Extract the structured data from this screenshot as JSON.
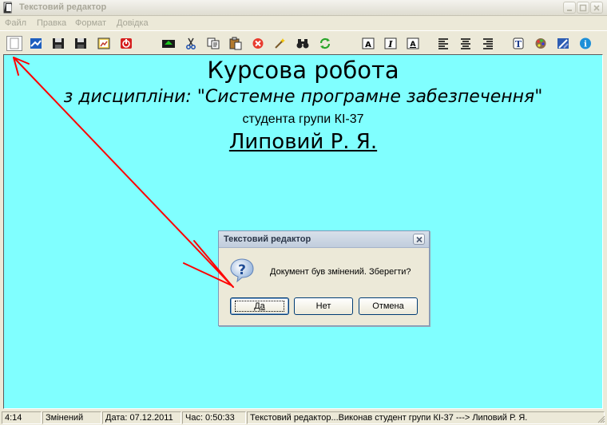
{
  "window": {
    "title": "Текстовий редактор"
  },
  "menu": [
    "Файл",
    "Правка",
    "Формат",
    "Довідка"
  ],
  "toolbar": {
    "buttons": [
      {
        "name": "new-document-button",
        "icon": "blank-page-icon"
      },
      {
        "name": "open-button",
        "icon": "open-folder-icon"
      },
      {
        "name": "save-button",
        "icon": "floppy-disk-icon"
      },
      {
        "name": "save-as-button",
        "icon": "floppy-disk-icon"
      },
      {
        "name": "print-preview-button",
        "icon": "picture-icon"
      },
      {
        "name": "exit-button",
        "icon": "power-icon"
      },
      {
        "name": "undo-button",
        "icon": "green-arrow-icon"
      },
      {
        "name": "cut-button",
        "icon": "scissors-icon"
      },
      {
        "name": "copy-button",
        "icon": "copy-icon"
      },
      {
        "name": "paste-button",
        "icon": "paste-icon"
      },
      {
        "name": "delete-button",
        "icon": "red-cross-icon"
      },
      {
        "name": "select-all-button",
        "icon": "wand-icon"
      },
      {
        "name": "find-button",
        "icon": "binoculars-icon"
      },
      {
        "name": "replace-button",
        "icon": "refresh-icon"
      },
      {
        "name": "bold-button",
        "icon": "letter-a-bold-icon"
      },
      {
        "name": "italic-button",
        "icon": "letter-i-italic-icon"
      },
      {
        "name": "underline-button",
        "icon": "letter-a-underline-icon"
      },
      {
        "name": "align-left-button",
        "icon": "align-left-icon"
      },
      {
        "name": "align-center-button",
        "icon": "align-center-icon"
      },
      {
        "name": "align-right-button",
        "icon": "align-right-icon"
      },
      {
        "name": "font-button",
        "icon": "font-icon"
      },
      {
        "name": "color-button",
        "icon": "palette-icon"
      },
      {
        "name": "background-button",
        "icon": "paint-bucket-icon"
      },
      {
        "name": "about-button",
        "icon": "info-icon"
      }
    ]
  },
  "document": {
    "line1": "Курсова робота",
    "line2_prefix": "з дисципліни",
    "line2_rest": ": \"Системне програмне забезпечення\"",
    "line3": "студента групи КІ-37",
    "line4": "Липовий Р. Я."
  },
  "dialog": {
    "title": "Текстовий редактор",
    "message": "Документ був змінений. Зберегти?",
    "buttons": {
      "yes": "Да",
      "no": "Нет",
      "cancel": "Отмена"
    }
  },
  "status": {
    "position": "4:14",
    "state": "Змінений",
    "date": "Дата:  07.12.2011",
    "time": "Час:  0:50:33",
    "info": "Текстовий редактор...Виконав студент групи КІ-37 ---> Липовий Р. Я."
  },
  "colors": {
    "editor_background": "#80ffff",
    "annotation_arrows": "#ff0000"
  }
}
